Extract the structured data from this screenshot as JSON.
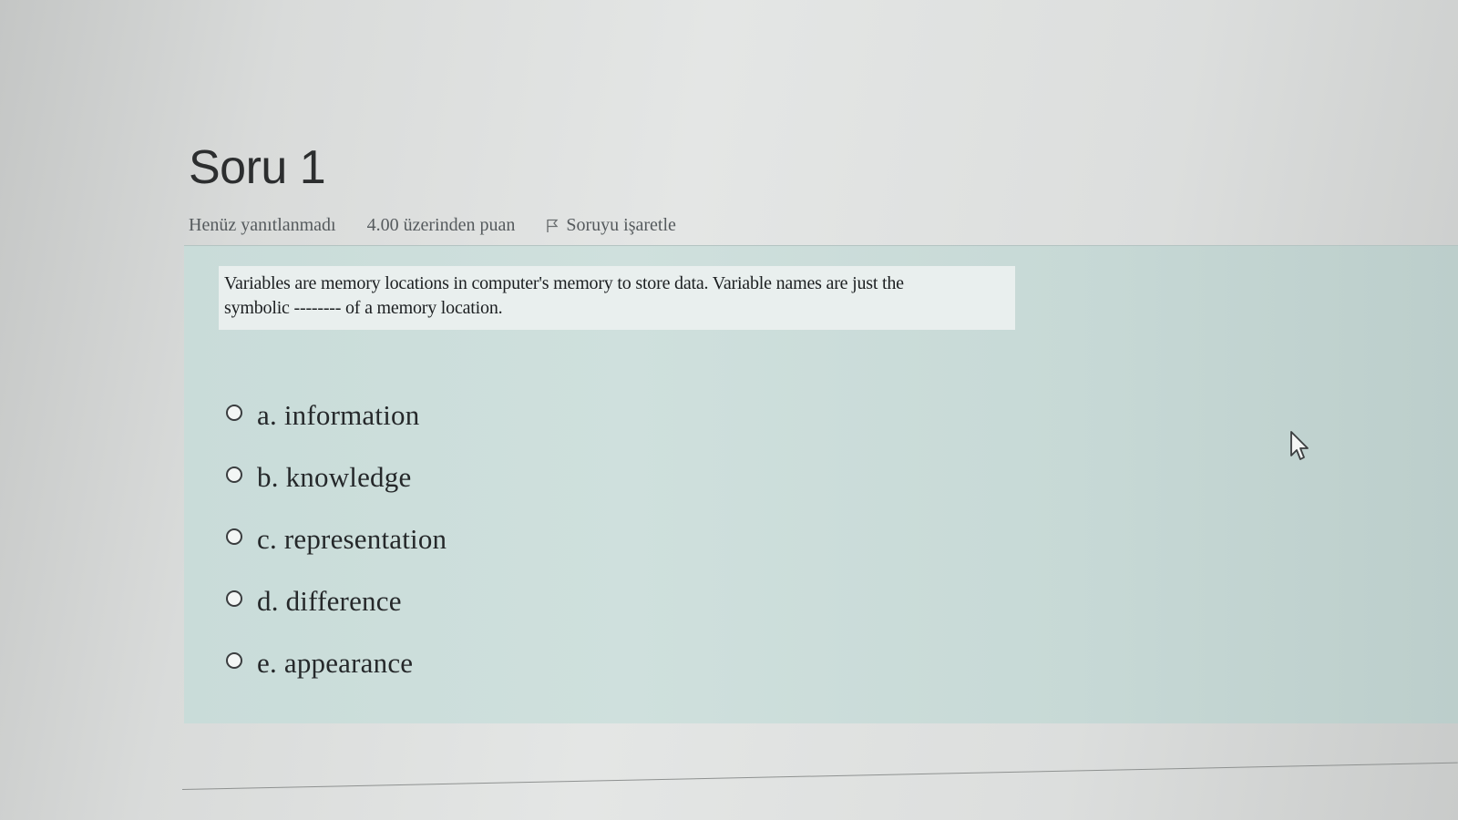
{
  "question": {
    "title": "Soru 1",
    "status": "Henüz yanıtlanmadı",
    "grade": "4.00 üzerinden puan",
    "flag_label": "Soruyu işaretle",
    "flag_icon": "flag-icon",
    "text_line1": "Variables are memory locations in computer's memory to store data. Variable names are just the",
    "text_line2": "symbolic -------- of a memory location.",
    "options": [
      {
        "label": "a. information",
        "selected": false
      },
      {
        "label": "b. knowledge",
        "selected": false
      },
      {
        "label": "c. representation",
        "selected": false
      },
      {
        "label": "d. difference",
        "selected": false
      },
      {
        "label": "e. appearance",
        "selected": false
      }
    ]
  },
  "colors": {
    "panel_background": "#cfe0dd",
    "title_text": "#2c2e2f",
    "meta_text": "#555a5d"
  }
}
